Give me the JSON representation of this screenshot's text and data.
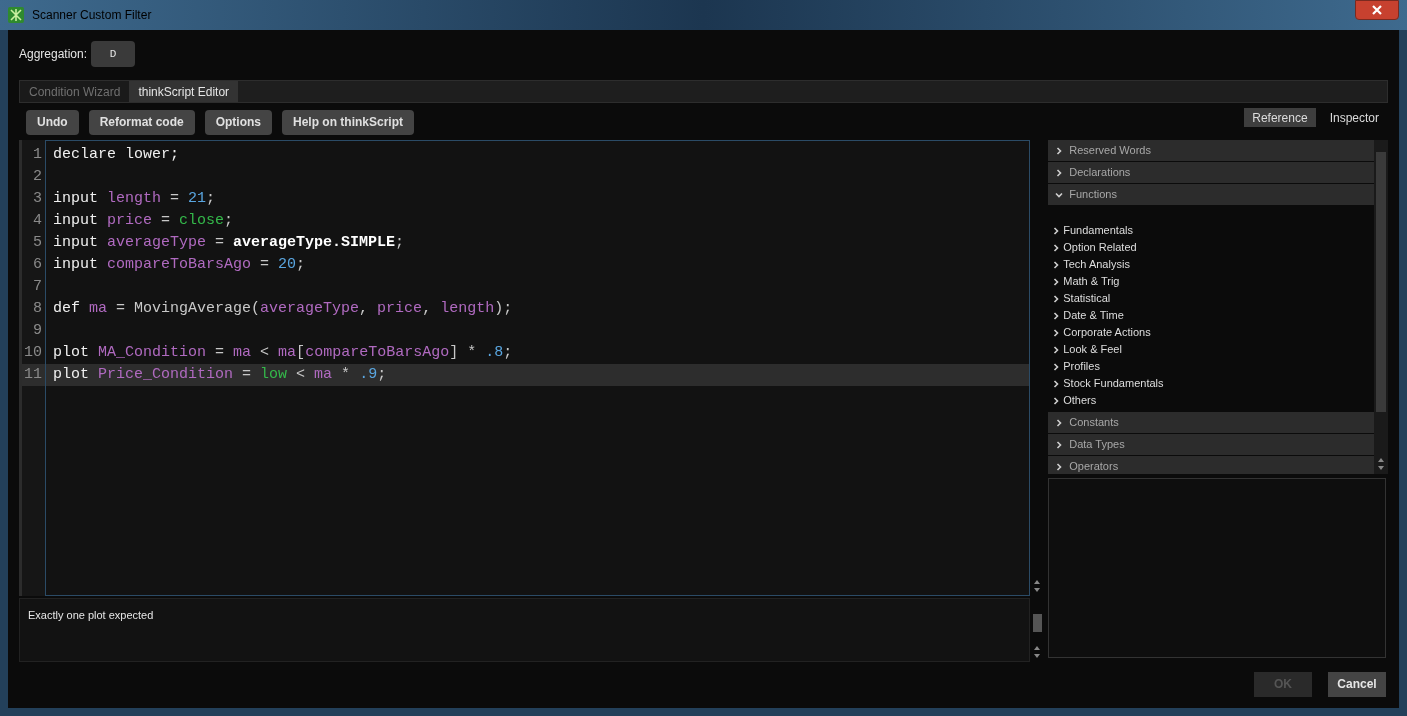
{
  "window": {
    "title": "Scanner Custom Filter"
  },
  "aggregation": {
    "label": "Aggregation:",
    "value": "D"
  },
  "tabs": [
    {
      "label": "Condition Wizard",
      "selected": false
    },
    {
      "label": "thinkScript Editor",
      "selected": true
    }
  ],
  "toolbar": [
    "Undo",
    "Reformat code",
    "Options",
    "Help on thinkScript"
  ],
  "side_tabs": [
    {
      "label": "Reference",
      "selected": true
    },
    {
      "label": "Inspector",
      "selected": false
    }
  ],
  "code_lines": [
    {
      "number": "1",
      "current": false,
      "tokens": [
        {
          "kind": "keyword",
          "text": "declare lower;"
        }
      ]
    },
    {
      "number": "2",
      "current": false
    },
    {
      "number": "3",
      "current": false,
      "tokens": [
        {
          "kind": "keyword",
          "text": "input "
        },
        {
          "kind": "param",
          "text": "length"
        },
        {
          "kind": "plain",
          "text": " = "
        },
        {
          "kind": "number",
          "text": "21"
        },
        {
          "kind": "plain",
          "text": ";"
        }
      ]
    },
    {
      "number": "4",
      "current": false,
      "tokens": [
        {
          "kind": "keyword",
          "text": "input "
        },
        {
          "kind": "param",
          "text": "price"
        },
        {
          "kind": "plain",
          "text": " = "
        },
        {
          "kind": "builtin",
          "text": "close"
        },
        {
          "kind": "plain",
          "text": ";"
        }
      ]
    },
    {
      "number": "5",
      "current": false,
      "tokens": [
        {
          "kind": "keyword",
          "text": "input "
        },
        {
          "kind": "param",
          "text": "averageType"
        },
        {
          "kind": "plain",
          "text": " = "
        },
        {
          "kind": "bold",
          "text": "averageType.SIMPLE"
        },
        {
          "kind": "plain",
          "text": ";"
        }
      ]
    },
    {
      "number": "6",
      "current": false,
      "tokens": [
        {
          "kind": "keyword",
          "text": "input "
        },
        {
          "kind": "param",
          "text": "compareToBarsAgo"
        },
        {
          "kind": "plain",
          "text": " = "
        },
        {
          "kind": "number",
          "text": "20"
        },
        {
          "kind": "plain",
          "text": ";"
        }
      ]
    },
    {
      "number": "7",
      "current": false
    },
    {
      "number": "8",
      "current": false,
      "tokens": [
        {
          "kind": "keyword",
          "text": "def "
        },
        {
          "kind": "param",
          "text": "ma"
        },
        {
          "kind": "plain",
          "text": " = MovingAverage("
        },
        {
          "kind": "param",
          "text": "averageType"
        },
        {
          "kind": "plain",
          "text": ", "
        },
        {
          "kind": "param",
          "text": "price"
        },
        {
          "kind": "plain",
          "text": ", "
        },
        {
          "kind": "param",
          "text": "length"
        },
        {
          "kind": "plain",
          "text": ");"
        }
      ]
    },
    {
      "number": "9",
      "current": false
    },
    {
      "number": "10",
      "current": false,
      "tokens": [
        {
          "kind": "keyword",
          "text": "plot "
        },
        {
          "kind": "param",
          "text": "MA_Condition"
        },
        {
          "kind": "plain",
          "text": " = "
        },
        {
          "kind": "param",
          "text": "ma"
        },
        {
          "kind": "plain",
          "text": " < "
        },
        {
          "kind": "param",
          "text": "ma"
        },
        {
          "kind": "plain",
          "text": "["
        },
        {
          "kind": "param",
          "text": "compareToBarsAgo"
        },
        {
          "kind": "plain",
          "text": "] * "
        },
        {
          "kind": "number",
          "text": ".8"
        },
        {
          "kind": "plain",
          "text": ";"
        }
      ]
    },
    {
      "number": "11",
      "current": true,
      "tokens": [
        {
          "kind": "keyword",
          "text": "plot "
        },
        {
          "kind": "param",
          "text": "Price_Condition"
        },
        {
          "kind": "plain",
          "text": " = "
        },
        {
          "kind": "builtin",
          "text": "low"
        },
        {
          "kind": "plain",
          "text": " < "
        },
        {
          "kind": "param",
          "text": "ma"
        },
        {
          "kind": "plain",
          "text": " * "
        },
        {
          "kind": "number",
          "text": ".9"
        },
        {
          "kind": "plain",
          "text": ";"
        }
      ]
    }
  ],
  "messages": "Exactly one plot expected",
  "reference": [
    {
      "label": "Reserved Words",
      "expanded": false
    },
    {
      "label": "Declarations",
      "expanded": false
    },
    {
      "label": "Functions",
      "expanded": true,
      "children": [
        "Fundamentals",
        "Option Related",
        "Tech Analysis",
        "Math & Trig",
        "Statistical",
        "Date & Time",
        "Corporate Actions",
        "Look & Feel",
        "Profiles",
        "Stock Fundamentals",
        "Others"
      ]
    },
    {
      "label": "Constants",
      "expanded": false
    },
    {
      "label": "Data Types",
      "expanded": false
    },
    {
      "label": "Operators",
      "expanded": false
    }
  ],
  "footer_buttons": [
    {
      "label": "OK",
      "disabled": true
    },
    {
      "label": "Cancel",
      "disabled": false
    }
  ]
}
